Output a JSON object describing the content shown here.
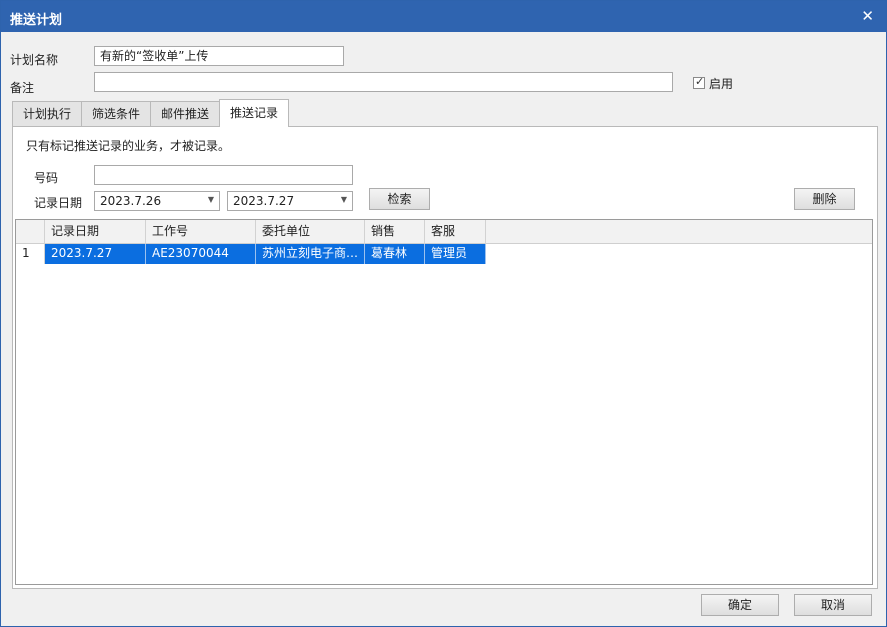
{
  "window": {
    "title": "推送计划",
    "close_glyph": "✕"
  },
  "form": {
    "plan_name_label": "计划名称",
    "plan_name_value": "有新的“签收单”上传",
    "remark_label": "备注",
    "remark_value": "",
    "enable_label": "启用",
    "enable_checked": true,
    "check_glyph": "✓"
  },
  "tabs": [
    {
      "label": "计划执行",
      "active": false
    },
    {
      "label": "筛选条件",
      "active": false
    },
    {
      "label": "邮件推送",
      "active": false
    },
    {
      "label": "推送记录",
      "active": true
    }
  ],
  "records": {
    "note": "只有标记推送记录的业务，才被记录。",
    "number_label": "号码",
    "number_value": "",
    "date_label": "记录日期",
    "date_from": "2023.7.26",
    "date_to": "2023.7.27",
    "search_button": "检索",
    "delete_button": "删除",
    "columns": [
      "记录日期",
      "工作号",
      "委托单位",
      "销售",
      "客服"
    ],
    "rows": [
      {
        "index": "1",
        "cells": [
          "2023.7.27",
          "AE23070044",
          "苏州立刻电子商…",
          "葛春林",
          "管理员"
        ],
        "selected": true
      }
    ]
  },
  "footer": {
    "ok_button": "确定",
    "cancel_button": "取消"
  },
  "colors": {
    "titlebar": "#2f64b0",
    "selection": "#0b6ee0"
  }
}
